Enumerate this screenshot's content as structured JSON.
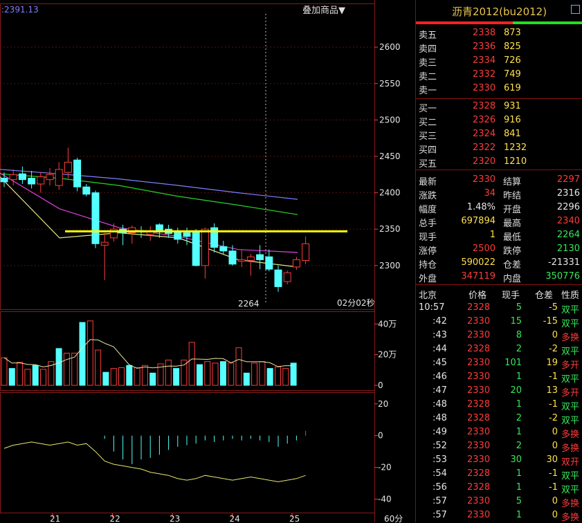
{
  "chart_header": {
    "ma_value": ":2391.13",
    "overlay_button": "叠加商品▼"
  },
  "chart_data": [
    {
      "type": "candlestick",
      "x_ticks": [
        "21",
        "22",
        "23",
        "24",
        "25"
      ],
      "x_unit": "60分",
      "y_ticks": [
        2300,
        2350,
        2400,
        2450,
        2500,
        2550,
        2600
      ],
      "ylim": [
        2240,
        2660
      ],
      "min_label": "2264",
      "countdown": "02分02秒",
      "reference_line": 2347,
      "candles": [
        {
          "o": 2420,
          "h": 2428,
          "l": 2408,
          "c": 2415
        },
        {
          "o": 2418,
          "h": 2432,
          "l": 2410,
          "c": 2425
        },
        {
          "o": 2426,
          "h": 2436,
          "l": 2412,
          "c": 2418
        },
        {
          "o": 2420,
          "h": 2430,
          "l": 2406,
          "c": 2412
        },
        {
          "o": 2412,
          "h": 2428,
          "l": 2400,
          "c": 2422
        },
        {
          "o": 2418,
          "h": 2434,
          "l": 2410,
          "c": 2425
        },
        {
          "o": 2410,
          "h": 2442,
          "l": 2404,
          "c": 2432
        },
        {
          "o": 2428,
          "h": 2462,
          "l": 2420,
          "c": 2442
        },
        {
          "o": 2445,
          "h": 2448,
          "l": 2402,
          "c": 2408
        },
        {
          "o": 2408,
          "h": 2412,
          "l": 2395,
          "c": 2398
        },
        {
          "o": 2400,
          "h": 2403,
          "l": 2324,
          "c": 2330
        },
        {
          "o": 2328,
          "h": 2345,
          "l": 2280,
          "c": 2332
        },
        {
          "o": 2338,
          "h": 2358,
          "l": 2333,
          "c": 2350
        },
        {
          "o": 2350,
          "h": 2356,
          "l": 2328,
          "c": 2345
        },
        {
          "o": 2345,
          "h": 2355,
          "l": 2330,
          "c": 2352
        },
        {
          "o": 2348,
          "h": 2354,
          "l": 2338,
          "c": 2346
        },
        {
          "o": 2343,
          "h": 2354,
          "l": 2334,
          "c": 2347
        },
        {
          "o": 2356,
          "h": 2358,
          "l": 2338,
          "c": 2346
        },
        {
          "o": 2350,
          "h": 2356,
          "l": 2338,
          "c": 2344
        },
        {
          "o": 2347,
          "h": 2352,
          "l": 2330,
          "c": 2336
        },
        {
          "o": 2345,
          "h": 2352,
          "l": 2328,
          "c": 2340
        },
        {
          "o": 2347,
          "h": 2350,
          "l": 2299,
          "c": 2300
        },
        {
          "o": 2300,
          "h": 2352,
          "l": 2282,
          "c": 2350
        },
        {
          "o": 2352,
          "h": 2358,
          "l": 2318,
          "c": 2325
        },
        {
          "o": 2326,
          "h": 2334,
          "l": 2315,
          "c": 2320
        },
        {
          "o": 2320,
          "h": 2328,
          "l": 2300,
          "c": 2302
        },
        {
          "o": 2306,
          "h": 2322,
          "l": 2298,
          "c": 2308
        },
        {
          "o": 2307,
          "h": 2316,
          "l": 2286,
          "c": 2312
        },
        {
          "o": 2315,
          "h": 2328,
          "l": 2295,
          "c": 2308
        },
        {
          "o": 2312,
          "h": 2322,
          "l": 2292,
          "c": 2295
        },
        {
          "o": 2294,
          "h": 2300,
          "l": 2264,
          "c": 2271
        },
        {
          "o": 2278,
          "h": 2293,
          "l": 2274,
          "c": 2290
        },
        {
          "o": 2298,
          "h": 2312,
          "l": 2294,
          "c": 2308
        },
        {
          "o": 2307,
          "h": 2340,
          "l": 2302,
          "c": 2330
        }
      ],
      "ma_lines": [
        {
          "color": "#7f7fff",
          "values": [
            2432,
            2426,
            2419,
            2410,
            2400,
            2391
          ]
        },
        {
          "color": "#28d428",
          "values": [
            2426,
            2420,
            2410,
            2395,
            2383,
            2370
          ]
        },
        {
          "color": "#e040e0",
          "values": [
            2427,
            2378,
            2352,
            2340,
            2322,
            2318
          ]
        },
        {
          "color": "#e8e88a",
          "values": [
            2422,
            2338,
            2345,
            2338,
            2308,
            2298
          ]
        }
      ],
      "volume": {
        "y_ticks": [
          "40万",
          "20万",
          "0"
        ],
        "max": 460000,
        "values": [
          180000,
          110000,
          150000,
          105000,
          130000,
          105000,
          155000,
          240000,
          210000,
          210000,
          410000,
          420000,
          230000,
          85000,
          110000,
          115000,
          130000,
          115000,
          130000,
          80000,
          140000,
          165000,
          110000,
          165000,
          280000,
          135000,
          155000,
          145000,
          155000,
          145000,
          245000,
          80000,
          145000,
          155000,
          110000,
          120000,
          110000,
          145000
        ]
      },
      "macd": {
        "y_ticks": [
          "20",
          "0",
          "-20",
          "-40"
        ],
        "ylim": [
          -48,
          26
        ],
        "bars": [
          0,
          0,
          0,
          0,
          0,
          0,
          0,
          0,
          0,
          0,
          0,
          -2,
          -10,
          -15,
          -18,
          -15,
          -14,
          -12,
          -9,
          -7,
          -6,
          -5,
          -3,
          -4,
          -3,
          -2,
          -3,
          -2,
          -3,
          -4,
          -7,
          -5,
          -3,
          3
        ],
        "line_values": [
          -8,
          -6,
          -5,
          -4,
          -5,
          -6,
          -5,
          -4,
          -6,
          -5,
          -10,
          -16,
          -18,
          -19,
          -20,
          -21,
          -23,
          -24,
          -25,
          -27,
          -28,
          -27,
          -25,
          -26,
          -27,
          -28,
          -27,
          -26,
          -27,
          -28,
          -29,
          -28,
          -27,
          -25
        ]
      }
    }
  ],
  "quote_panel": {
    "title_name": "沥青2012",
    "title_code": "(bu2012)",
    "asks": [
      {
        "label": "卖五",
        "price": "2338",
        "vol": "873"
      },
      {
        "label": "卖四",
        "price": "2336",
        "vol": "825"
      },
      {
        "label": "卖三",
        "price": "2334",
        "vol": "726"
      },
      {
        "label": "卖二",
        "price": "2332",
        "vol": "749"
      },
      {
        "label": "卖一",
        "price": "2330",
        "vol": "619"
      }
    ],
    "bids": [
      {
        "label": "买一",
        "price": "2328",
        "vol": "931"
      },
      {
        "label": "买二",
        "price": "2326",
        "vol": "916"
      },
      {
        "label": "买三",
        "price": "2324",
        "vol": "841"
      },
      {
        "label": "买四",
        "price": "2322",
        "vol": "1232"
      },
      {
        "label": "买五",
        "price": "2320",
        "vol": "1210"
      }
    ],
    "stats": [
      {
        "l1": "最新",
        "v1": "2330",
        "c1": "red",
        "l2": "结算",
        "v2": "2297",
        "c2": "red"
      },
      {
        "l1": "涨跌",
        "v1": "34",
        "c1": "red",
        "l2": "昨结",
        "v2": "2316",
        "c2": "wht"
      },
      {
        "l1": "幅度",
        "v1": "1.48%",
        "c1": "wht",
        "l2": "开盘",
        "v2": "2296",
        "c2": "wht"
      },
      {
        "l1": "总手",
        "v1": "697894",
        "c1": "yel",
        "l2": "最高",
        "v2": "2340",
        "c2": "red"
      },
      {
        "l1": "现手",
        "v1": "1",
        "c1": "yel",
        "l2": "最低",
        "v2": "2264",
        "c2": "grn"
      },
      {
        "l1": "涨停",
        "v1": "2500",
        "c1": "red",
        "l2": "跌停",
        "v2": "2130",
        "c2": "grn"
      },
      {
        "l1": "持仓",
        "v1": "590022",
        "c1": "yel",
        "l2": "仓差",
        "v2": "-21331",
        "c2": "wht"
      },
      {
        "l1": "外盘",
        "v1": "347119",
        "c1": "red",
        "l2": "内盘",
        "v2": "350776",
        "c2": "grn"
      }
    ],
    "tick_headers": [
      "北京",
      "价格",
      "现手",
      "仓差",
      "性质"
    ],
    "ticks": [
      {
        "t": "10:57",
        "p": "2328",
        "pc": "red",
        "v": "5",
        "d": "-5",
        "n": "双平",
        "nc": "grn",
        "first": true
      },
      {
        "t": ":42",
        "p": "2330",
        "pc": "red",
        "v": "15",
        "d": "-15",
        "n": "双平",
        "nc": "grn"
      },
      {
        "t": ":43",
        "p": "2330",
        "pc": "red",
        "v": "8",
        "d": "0",
        "n": "多换",
        "nc": "red"
      },
      {
        "t": ":44",
        "p": "2328",
        "pc": "red",
        "v": "2",
        "d": "-2",
        "n": "双平",
        "nc": "grn"
      },
      {
        "t": ":45",
        "p": "2330",
        "pc": "red",
        "v": "101",
        "d": "19",
        "n": "多开",
        "nc": "red"
      },
      {
        "t": ":46",
        "p": "2330",
        "pc": "red",
        "v": "1",
        "d": "-1",
        "n": "双平",
        "nc": "grn"
      },
      {
        "t": ":47",
        "p": "2330",
        "pc": "red",
        "v": "20",
        "d": "13",
        "n": "多开",
        "nc": "red"
      },
      {
        "t": ":48",
        "p": "2328",
        "pc": "red",
        "v": "1",
        "d": "-1",
        "n": "双平",
        "nc": "grn"
      },
      {
        "t": ":48",
        "p": "2328",
        "pc": "red",
        "v": "2",
        "d": "-2",
        "n": "双平",
        "nc": "grn"
      },
      {
        "t": ":49",
        "p": "2330",
        "pc": "red",
        "v": "1",
        "d": "0",
        "n": "多换",
        "nc": "red"
      },
      {
        "t": ":52",
        "p": "2330",
        "pc": "red",
        "v": "2",
        "d": "0",
        "n": "多换",
        "nc": "red"
      },
      {
        "t": ":53",
        "p": "2330",
        "pc": "red",
        "v": "30",
        "d": "30",
        "n": "双开",
        "nc": "red"
      },
      {
        "t": ":54",
        "p": "2328",
        "pc": "red",
        "v": "1",
        "d": "-1",
        "n": "双平",
        "nc": "grn"
      },
      {
        "t": ":56",
        "p": "2328",
        "pc": "red",
        "v": "1",
        "d": "-1",
        "n": "双平",
        "nc": "grn"
      },
      {
        "t": ":57",
        "p": "2330",
        "pc": "red",
        "v": "5",
        "d": "0",
        "n": "多换",
        "nc": "red"
      },
      {
        "t": ":57",
        "p": "2330",
        "pc": "red",
        "v": "1",
        "d": "0",
        "n": "多换",
        "nc": "red"
      }
    ]
  }
}
